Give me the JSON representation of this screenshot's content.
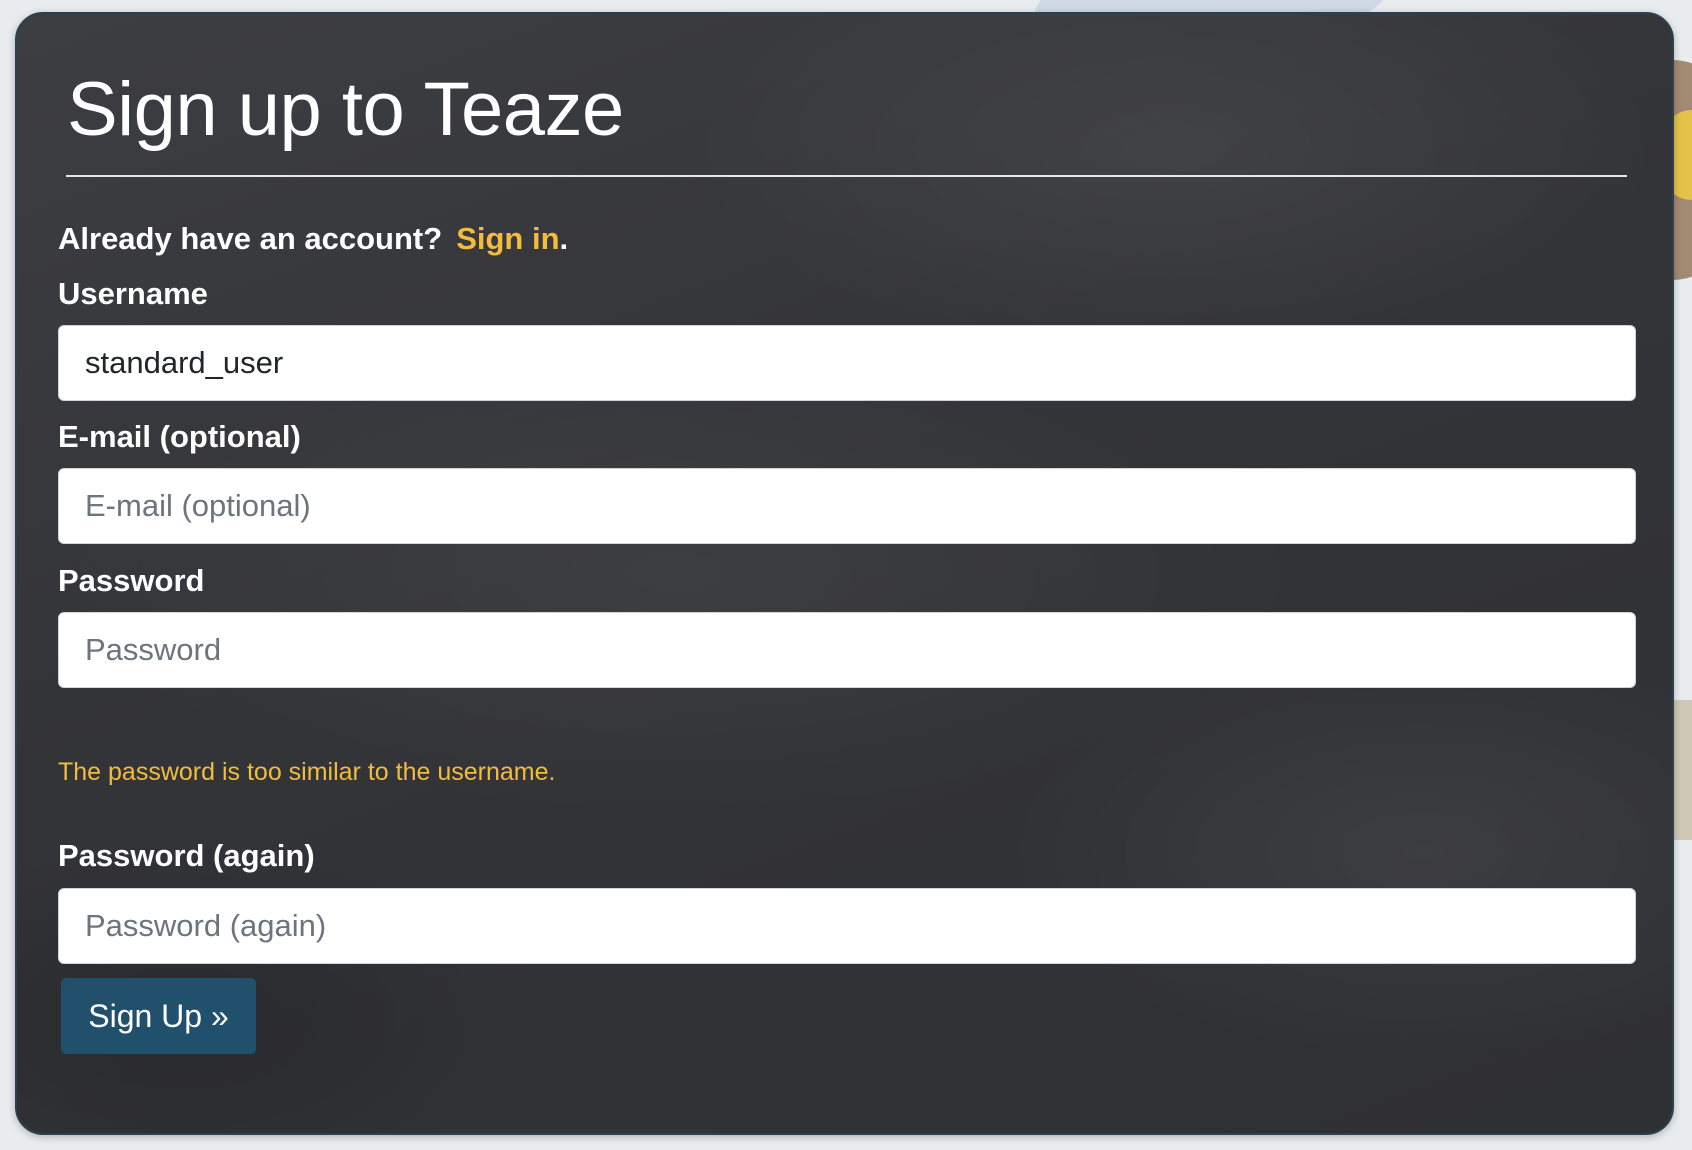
{
  "page": {
    "title": "Sign up to Teaze"
  },
  "signin": {
    "prompt": "Already have an account?",
    "link_label": "Sign in",
    "trailing": "."
  },
  "form": {
    "username": {
      "label": "Username",
      "value": "standard_user"
    },
    "email": {
      "label": "E-mail (optional)",
      "placeholder": "E-mail (optional)",
      "value": ""
    },
    "password": {
      "label": "Password",
      "placeholder": "Password",
      "value": "",
      "help_text": "The password is too similar to the username."
    },
    "password_again": {
      "label": "Password (again)",
      "placeholder": "Password (again)",
      "value": ""
    },
    "submit_label": "Sign Up »"
  },
  "colors": {
    "accent_link": "#f2bc3d",
    "button": "#21506c",
    "card_background": "#36373b"
  }
}
